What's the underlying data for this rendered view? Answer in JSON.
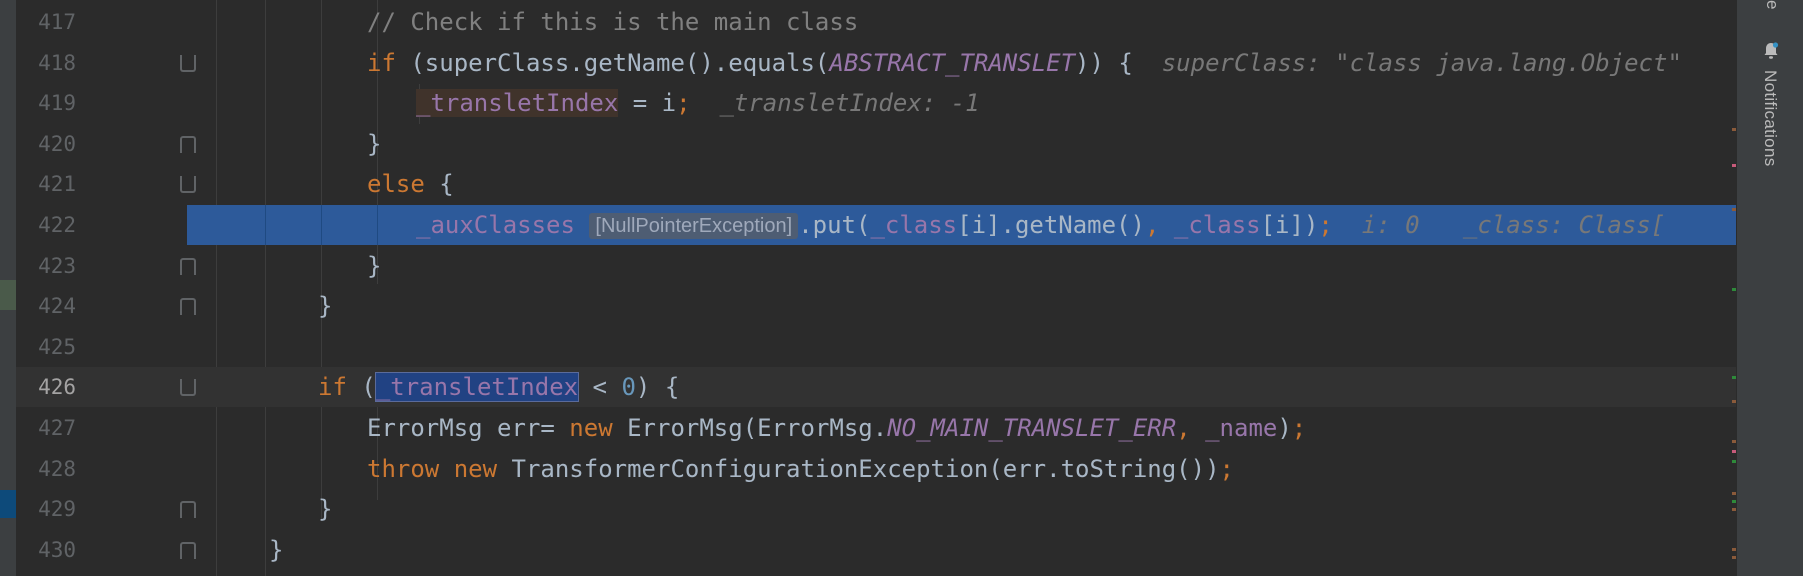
{
  "editor": {
    "current_line": "426",
    "lines": [
      {
        "no": "417",
        "segments": [
          {
            "t": "// Check if this is the main class",
            "c": "cm"
          }
        ]
      },
      {
        "no": "418",
        "segments": [
          {
            "t": "if",
            "c": "kw"
          },
          {
            "t": " (superClass.getName().equals(",
            "c": ""
          },
          {
            "t": "ABSTRACT_TRANSLET",
            "c": "cst"
          },
          {
            "t": ")) {  ",
            "c": ""
          },
          {
            "t": "superClass: \"class java.lang.Object\"",
            "c": "hint"
          }
        ]
      },
      {
        "no": "419",
        "segments": [
          {
            "t": "_transletIndex",
            "c": "fld assign-bg"
          },
          {
            "t": " = i",
            "c": ""
          },
          {
            "t": ";",
            "c": "kw"
          },
          {
            "t": "  _transletIndex: -1",
            "c": "hint"
          }
        ]
      },
      {
        "no": "420",
        "segments": [
          {
            "t": "}",
            "c": ""
          }
        ]
      },
      {
        "no": "421",
        "segments": [
          {
            "t": "else",
            "c": "kw"
          },
          {
            "t": " {",
            "c": ""
          }
        ]
      },
      {
        "no": "422",
        "segments": [
          {
            "t": "_auxClasses",
            "c": "fld"
          },
          {
            "t": " ",
            "c": ""
          },
          {
            "t": "[NullPointerException]",
            "c": "npe"
          },
          {
            "t": ".put(",
            "c": ""
          },
          {
            "t": "_class",
            "c": "fld"
          },
          {
            "t": "[i].getName()",
            "c": ""
          },
          {
            "t": ", ",
            "c": "kw"
          },
          {
            "t": "_class",
            "c": "fld"
          },
          {
            "t": "[i])",
            "c": ""
          },
          {
            "t": ";",
            "c": "kw"
          },
          {
            "t": "  i: 0   _class: Class[",
            "c": "hint"
          }
        ]
      },
      {
        "no": "423",
        "segments": [
          {
            "t": "}",
            "c": ""
          }
        ]
      },
      {
        "no": "424",
        "segments": [
          {
            "t": "}",
            "c": ""
          }
        ]
      },
      {
        "no": "425",
        "segments": []
      },
      {
        "no": "426",
        "segments": [
          {
            "t": "if",
            "c": "kw"
          },
          {
            "t": " (",
            "c": ""
          },
          {
            "t": "_transletIndex",
            "c": "fld sel-word"
          },
          {
            "t": " < ",
            "c": ""
          },
          {
            "t": "0",
            "c": "num"
          },
          {
            "t": ") {",
            "c": ""
          }
        ]
      },
      {
        "no": "427",
        "segments": [
          {
            "t": "ErrorMsg err= ",
            "c": ""
          },
          {
            "t": "new",
            "c": "kw"
          },
          {
            "t": " ErrorMsg(ErrorMsg.",
            "c": ""
          },
          {
            "t": "NO_MAIN_TRANSLET_ERR",
            "c": "cst"
          },
          {
            "t": ", ",
            "c": "kw"
          },
          {
            "t": "_name",
            "c": "fld"
          },
          {
            "t": ")",
            "c": ""
          },
          {
            "t": ";",
            "c": "kw"
          }
        ]
      },
      {
        "no": "428",
        "segments": [
          {
            "t": "throw",
            "c": "kw"
          },
          {
            "t": " ",
            "c": ""
          },
          {
            "t": "new",
            "c": "kw"
          },
          {
            "t": " TransformerConfigurationException(err.toString())",
            "c": ""
          },
          {
            "t": ";",
            "c": "kw"
          }
        ]
      },
      {
        "no": "429",
        "segments": [
          {
            "t": "}",
            "c": ""
          }
        ]
      },
      {
        "no": "430",
        "segments": [
          {
            "t": "}",
            "c": ""
          }
        ]
      }
    ]
  },
  "right_panel": {
    "top_label": "e",
    "notifications_label": "Notifications",
    "bell_icon": "bell-icon"
  },
  "colors": {
    "execution_line": "#2d5a9a",
    "keyword": "#cc7832",
    "field": "#9876aa",
    "comment": "#808080"
  }
}
